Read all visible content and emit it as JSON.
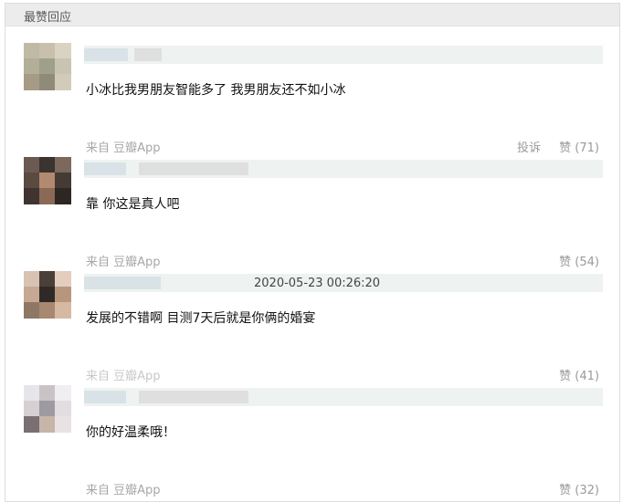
{
  "section": {
    "title": "最赞回应"
  },
  "comments": [
    {
      "text": "小冰比我男朋友智能多了 我男朋友还不如小冰",
      "timestamp": "",
      "source": "来自 豆瓣App",
      "report_label": "投诉",
      "like_label": "赞 (71)",
      "like_count": 71,
      "avatar_colors": [
        "#bfb9a6",
        "#c8c0ad",
        "#d9d3c2",
        "#b3ae98",
        "#9fa08a",
        "#c9c3b3",
        "#a79b87",
        "#8f8a7a",
        "#d2cbb9"
      ]
    },
    {
      "text": "靠 你这是真人吧",
      "timestamp": "",
      "source": "来自 豆瓣App",
      "report_label": "",
      "like_label": "赞 (54)",
      "like_count": 54,
      "avatar_colors": [
        "#6b5a52",
        "#3a3330",
        "#7c685c",
        "#5a4a40",
        "#b28a70",
        "#463a34",
        "#3f3430",
        "#8a6a55",
        "#2d2622"
      ]
    },
    {
      "text": "发展的不错啊 目测7天后就是你俩的婚宴",
      "timestamp": "2020-05-23 00:26:20",
      "source": "来自 豆瓣App",
      "report_label": "",
      "like_label": "赞 (41)",
      "like_count": 41,
      "avatar_colors": [
        "#d8c2b2",
        "#4a3f39",
        "#e2cdbf",
        "#c7a892",
        "#2f2a27",
        "#b8967e",
        "#8d7866",
        "#a88870",
        "#d6b9a3"
      ]
    },
    {
      "text": "你的好温柔哦！",
      "timestamp": "",
      "source": "来自 豆瓣App",
      "report_label": "",
      "like_label": "赞 (32)",
      "like_count": 32,
      "avatar_colors": [
        "#e6e6ea",
        "#c9c3c6",
        "#f0eef0",
        "#d6d0d2",
        "#9e9aa2",
        "#e1dde0",
        "#7a6f72",
        "#c7b6a8",
        "#e8e2e5"
      ]
    }
  ]
}
